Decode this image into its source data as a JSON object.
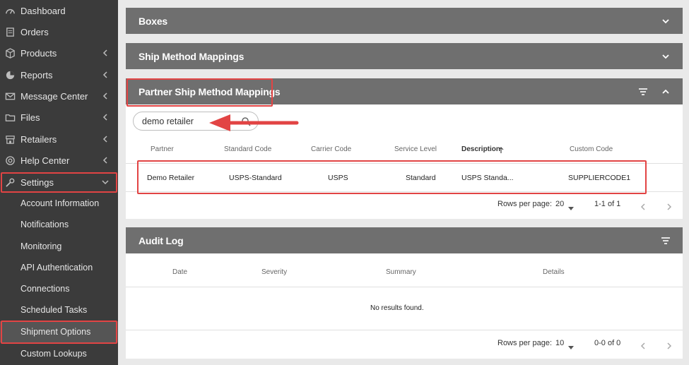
{
  "sidebar": {
    "items": [
      {
        "label": "Dashboard",
        "icon": "dashboard-icon"
      },
      {
        "label": "Orders",
        "icon": "orders-icon"
      },
      {
        "label": "Products",
        "icon": "products-icon"
      },
      {
        "label": "Reports",
        "icon": "reports-icon"
      },
      {
        "label": "Message Center",
        "icon": "envelope-icon"
      },
      {
        "label": "Files",
        "icon": "folder-icon"
      },
      {
        "label": "Retailers",
        "icon": "store-icon"
      },
      {
        "label": "Help Center",
        "icon": "lifebuoy-icon"
      },
      {
        "label": "Settings",
        "icon": "wrench-icon"
      }
    ],
    "settings_sub": [
      {
        "label": "Account Information"
      },
      {
        "label": "Notifications"
      },
      {
        "label": "Monitoring"
      },
      {
        "label": "API Authentication"
      },
      {
        "label": "Connections"
      },
      {
        "label": "Scheduled Tasks"
      },
      {
        "label": "Shipment Options"
      },
      {
        "label": "Custom Lookups"
      }
    ]
  },
  "panels": {
    "boxes": {
      "title": "Boxes"
    },
    "ship_method": {
      "title": "Ship Method Mappings"
    },
    "partner": {
      "title": "Partner Ship Method Mappings",
      "search_value": "demo retailer",
      "columns": [
        "Partner",
        "Standard Code",
        "Carrier Code",
        "Service Level",
        "Description",
        "Custom Code"
      ],
      "sort_icon": "arrow-up-icon",
      "row": [
        "Demo Retailer",
        "USPS-Standard",
        "USPS",
        "Standard",
        "USPS Standa...",
        "SUPPLIERCODE1"
      ],
      "rows_per_page_label": "Rows per page:",
      "rows_per_page": "20",
      "range": "1-1 of 1"
    },
    "audit": {
      "title": "Audit Log",
      "columns": [
        "Date",
        "Severity",
        "Summary",
        "Details"
      ],
      "empty": "No results found.",
      "rows_per_page_label": "Rows per page:",
      "rows_per_page": "10",
      "range": "0-0 of 0"
    }
  },
  "colors": {
    "sidebar_bg": "#3b3b3b",
    "header_bg": "#6f6f6f",
    "highlight": "#e24444"
  }
}
